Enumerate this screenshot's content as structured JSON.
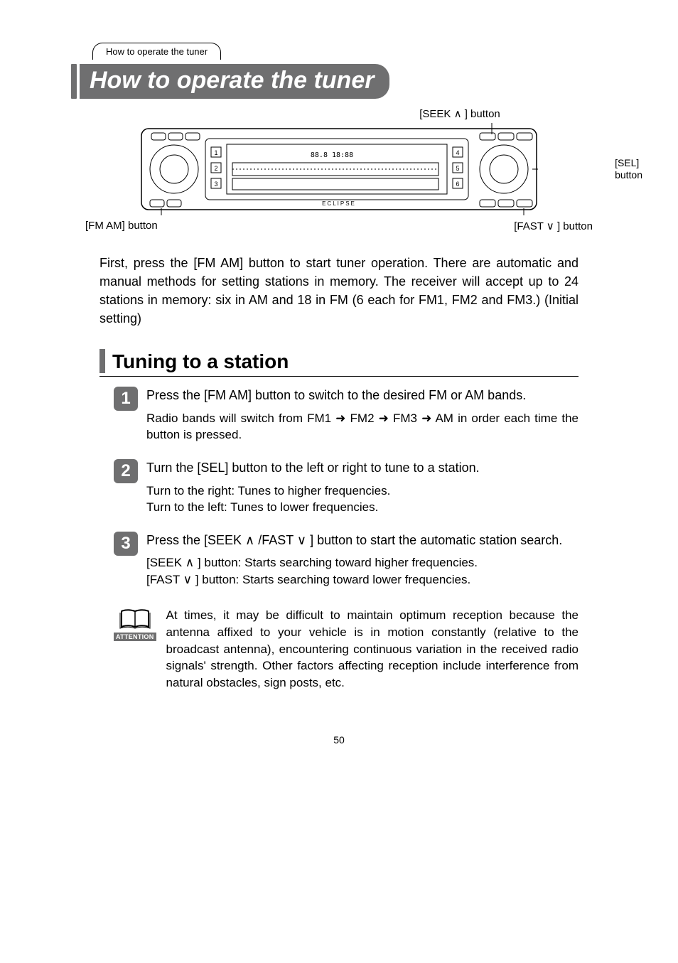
{
  "tab": {
    "label": "How to operate the tuner"
  },
  "title": "How to operate the tuner",
  "diagram": {
    "seek_label": "[SEEK ∧ ] button",
    "sel_label_line1": "[SEL]",
    "sel_label_line2": "button",
    "fm_am_label": "[FM AM] button",
    "fast_label": "[FAST ∨ ] button"
  },
  "intro": "First, press the [FM AM] button to start tuner operation. There are automatic and manual methods for setting stations in memory.  The receiver will accept up to 24 stations in memory: six in AM and 18 in FM (6 each for FM1, FM2 and FM3.) (Initial setting)",
  "section_heading": "Tuning to a station",
  "steps": [
    {
      "num": "1",
      "title": "Press the [FM AM] button to switch to the desired FM or AM bands.",
      "desc": "Radio bands will switch from FM1 ➜ FM2 ➜ FM3 ➜ AM in order each time the button is pressed."
    },
    {
      "num": "2",
      "title": "Turn the [SEL] button to the left or right to tune to a station.",
      "desc": "Turn to the right:  Tunes to higher frequencies.\nTurn to the left:     Tunes to lower frequencies."
    },
    {
      "num": "3",
      "title": "Press the [SEEK ∧ /FAST ∨ ] button to start the automatic station search.",
      "desc": "[SEEK ∧ ] button:  Starts searching toward higher frequencies.\n[FAST ∨ ] button:  Starts searching toward lower frequencies."
    }
  ],
  "attention": {
    "label": "ATTENTION",
    "text": "At times, it may be difficult to maintain optimum reception because the antenna affixed to your vehicle is in motion constantly (relative to the broadcast antenna), encountering continuous variation in the received radio signals' strength. Other factors affecting reception include interference from natural obstacles, sign posts, etc."
  },
  "page_number": "50"
}
